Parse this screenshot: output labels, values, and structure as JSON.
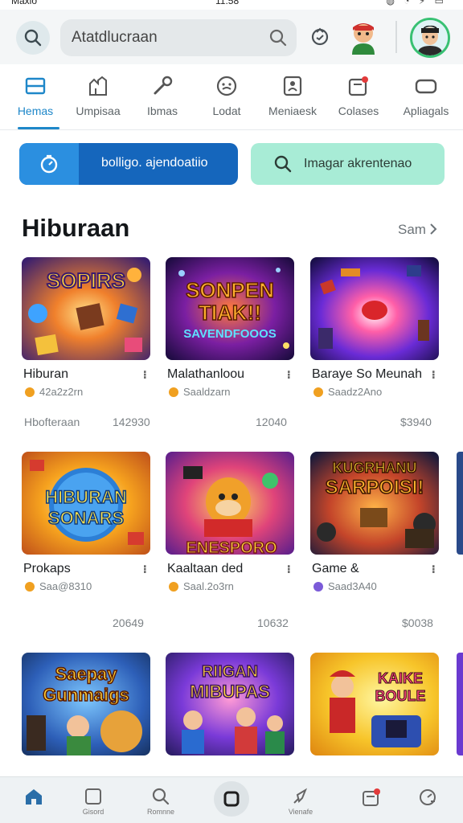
{
  "status_bar": {
    "carrier": "Maxio",
    "time": "11:58"
  },
  "header": {
    "search": {
      "value": "Atatdlucraan",
      "placeholder": "Atatdlucraan"
    }
  },
  "tabs": [
    {
      "label": "Hemas",
      "icon": "home-square-icon",
      "active": true
    },
    {
      "label": "Umpisaa",
      "icon": "castle-icon",
      "active": false
    },
    {
      "label": "Ibmas",
      "icon": "wrench-icon",
      "active": false
    },
    {
      "label": "Lodat",
      "icon": "clock-badge-icon",
      "active": false
    },
    {
      "label": "Meniaesk",
      "icon": "person-square-icon",
      "active": false
    },
    {
      "label": "Colases",
      "icon": "calendar-badge-icon",
      "active": false
    },
    {
      "label": "Apliagals",
      "icon": "rounded-rect-icon",
      "active": false
    }
  ],
  "actions": {
    "primary_label": "bolligo. ajendoatiio",
    "secondary_label": "Imagar akrentenao"
  },
  "section": {
    "title": "Hiburaan",
    "see_all": "Sam"
  },
  "rows": [
    {
      "note_left": "Hbofteraan",
      "cards": [
        {
          "title": "Hiburan",
          "meta": "42a2z2rn",
          "note": "142930",
          "thumb_text": [
            "SOPIRS"
          ]
        },
        {
          "title": "Malathanloou",
          "meta": "Saaldzarn",
          "note": "12040",
          "thumb_text": [
            "SONPEN",
            "TIAK!!",
            "SAVENDFOOOS"
          ]
        },
        {
          "title": "Baraye So Meunah",
          "meta": "Saadz2Ano",
          "note": "$3940",
          "thumb_text": []
        }
      ]
    },
    {
      "note_left": "",
      "cards": [
        {
          "title": "Prokaps",
          "meta": "Saa@8310",
          "note": "20649",
          "thumb_text": [
            "HIBURAN",
            "SONARS"
          ]
        },
        {
          "title": "Kaaltaan ded",
          "meta": "Saal.2o3rn",
          "note": "10632",
          "thumb_text": [
            "ENESPORO"
          ]
        },
        {
          "title": "Game &",
          "meta": "Saad3A40",
          "note": "$0038",
          "thumb_text": [
            "KUGRHANU",
            "SARPOISI!"
          ]
        }
      ]
    },
    {
      "note_left": "",
      "cards": [
        {
          "title": "",
          "meta": "",
          "note": "",
          "thumb_text": [
            "Saepay",
            "Gunmaigs"
          ]
        },
        {
          "title": "",
          "meta": "",
          "note": "",
          "thumb_text": [
            "RIIGAN",
            "MIBUPAS"
          ]
        },
        {
          "title": "",
          "meta": "",
          "note": "",
          "thumb_text": [
            "KAIKE",
            "BOULE"
          ]
        }
      ]
    }
  ],
  "bottom_nav": [
    {
      "label": "",
      "icon": "home-icon"
    },
    {
      "label": "Gisord",
      "icon": "square-icon"
    },
    {
      "label": "Romnne",
      "icon": "search-icon"
    },
    {
      "label": "",
      "icon": "center-square-icon"
    },
    {
      "label": "Vienafe",
      "icon": "rocket-icon"
    },
    {
      "label": "",
      "icon": "calendar-badge-icon"
    },
    {
      "label": "",
      "icon": "gauge-icon"
    }
  ],
  "colors": {
    "accent": "#1e87c9",
    "primary_button": "#1566bc",
    "secondary_button": "#a8ecd6",
    "avatar_ring": "#38c173"
  }
}
